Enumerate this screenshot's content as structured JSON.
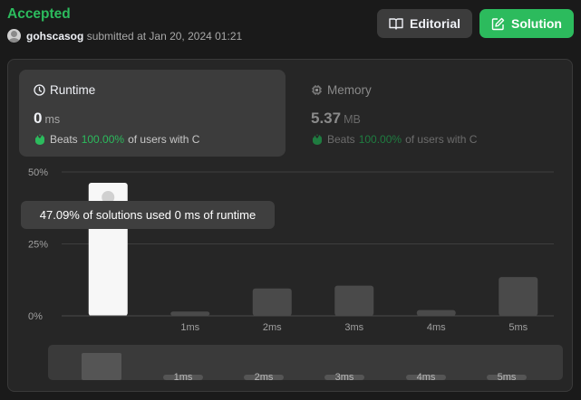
{
  "header": {
    "status": "Accepted",
    "username": "gohscasog",
    "submitted_text": "submitted at Jan 20, 2024 01:21",
    "editorial_label": "Editorial",
    "solution_label": "Solution"
  },
  "runtime": {
    "title": "Runtime",
    "value": "0",
    "unit": "ms",
    "beats_label": "Beats",
    "beats_pct": "100.00%",
    "beats_suffix": "of users with C"
  },
  "memory": {
    "title": "Memory",
    "value": "5.37",
    "unit": "MB",
    "beats_label": "Beats",
    "beats_pct": "100.00%",
    "beats_suffix": "of users with C"
  },
  "tooltip": "47.09% of solutions used 0 ms of runtime",
  "colors": {
    "accent": "#2cbb5d",
    "panel": "#3c3c3c",
    "bar": "#4a4a4a",
    "selected_bar": "#ffffff"
  },
  "chart_data": {
    "type": "bar",
    "categories": [
      "0ms",
      "1ms",
      "2ms",
      "3ms",
      "4ms",
      "5ms"
    ],
    "tick_labels": [
      "",
      "1ms",
      "2ms",
      "3ms",
      "4ms",
      "5ms"
    ],
    "values": [
      50,
      1.5,
      9.5,
      10.5,
      2,
      13.5
    ],
    "selected_index": 0,
    "yticks": [
      "0%",
      "25%",
      "50%"
    ],
    "ylim": [
      0,
      50
    ],
    "grid": true
  },
  "overview": {
    "tick_labels": [
      "1ms",
      "2ms",
      "3ms",
      "4ms",
      "5ms"
    ]
  }
}
